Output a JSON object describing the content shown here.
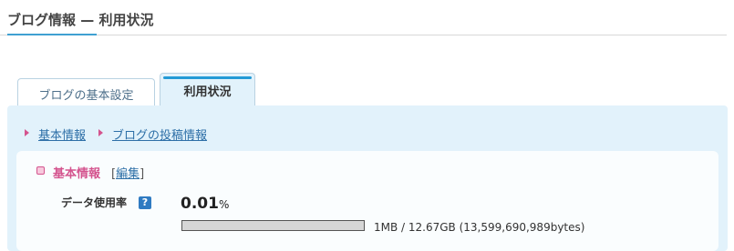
{
  "header": {
    "title": "ブログ情報 — 利用状況"
  },
  "tabs": [
    {
      "label": "ブログの基本設定",
      "active": false
    },
    {
      "label": "利用状況",
      "active": true
    }
  ],
  "subnav": [
    {
      "label": "基本情報"
    },
    {
      "label": "ブログの投稿情報"
    }
  ],
  "basic_info": {
    "title": "基本情報",
    "edit_label": "編集",
    "bracket_open": "[",
    "bracket_close": "]",
    "data_usage": {
      "label": "データ使用率",
      "help_icon": "?",
      "value": "0.01",
      "unit": "%",
      "progress_fraction": 0.0001,
      "capacity_text": "1MB / 12.67GB (13,599,690,989bytes)"
    }
  },
  "colors": {
    "accent_blue": "#239ad6",
    "link_blue": "#2d6fa7",
    "pink": "#d4548e",
    "panel_bg": "#e2f2fb",
    "progress_bg": "#d6d6d6"
  }
}
